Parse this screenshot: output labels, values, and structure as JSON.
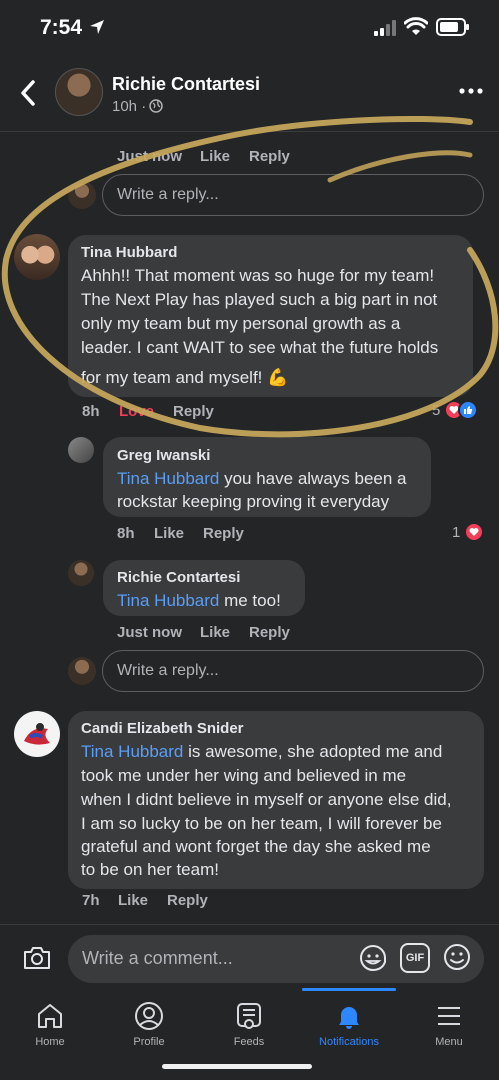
{
  "status_bar": {
    "time": "7:54"
  },
  "header": {
    "name": "Richie Contartesi",
    "time": "10h ·"
  },
  "prev_actions": {
    "time": "Just now",
    "like": "Like",
    "reply": "Reply"
  },
  "reply_box_1": {
    "placeholder": "Write a reply..."
  },
  "comments": [
    {
      "author": "Tina Hubbard",
      "text": [
        "Ahhh!! That moment was so huge for my team!",
        "The Next Play has played such a big part in not",
        "only my team but my personal growth as a",
        "leader. I cant WAIT to see what the future holds",
        "for my team and myself! 💪"
      ],
      "time": "8h",
      "reaction_label": "Love",
      "reply": "Reply",
      "reaction_count": "5"
    },
    {
      "author": "Greg Iwanski",
      "mention": "Tina Hubbard",
      "text_after_mention": " you have always been a",
      "text_line2": "rockstar keeping proving it everyday",
      "time": "8h",
      "like": "Like",
      "reply": "Reply",
      "reaction_count": "1"
    },
    {
      "author": "Richie Contartesi",
      "mention": "Tina Hubbard",
      "text_after_mention": " me too!",
      "time": "Just now",
      "like": "Like",
      "reply": "Reply"
    },
    {
      "author": "Candi Elizabeth Snider",
      "mention": "Tina Hubbard",
      "text_after_mention": " is awesome, she adopted me and",
      "text": [
        "took me under her wing and believed in me",
        "when I didnt believe in myself or anyone else did,",
        "I am so lucky to be on her team, I will forever be",
        "grateful and wont forget the day she asked me",
        "to be on her team!"
      ],
      "time": "7h",
      "like": "Like",
      "reply": "Reply"
    }
  ],
  "reply_box_2": {
    "placeholder": "Write a reply..."
  },
  "comment_bar": {
    "placeholder": "Write a comment...",
    "gif_label": "GIF"
  },
  "tabs": [
    {
      "label": "Home",
      "icon": "home-icon"
    },
    {
      "label": "Profile",
      "icon": "profile-icon"
    },
    {
      "label": "Feeds",
      "icon": "feeds-icon"
    },
    {
      "label": "Notifications",
      "icon": "bell-icon",
      "active": true
    },
    {
      "label": "Menu",
      "icon": "menu-icon"
    }
  ],
  "colors": {
    "background": "#242526",
    "bubble": "#3a3b3c",
    "mention": "#5a9ef5",
    "love": "#f33e58",
    "active_tab": "#2d88ff",
    "annotation_circle": "#c9a85c"
  }
}
